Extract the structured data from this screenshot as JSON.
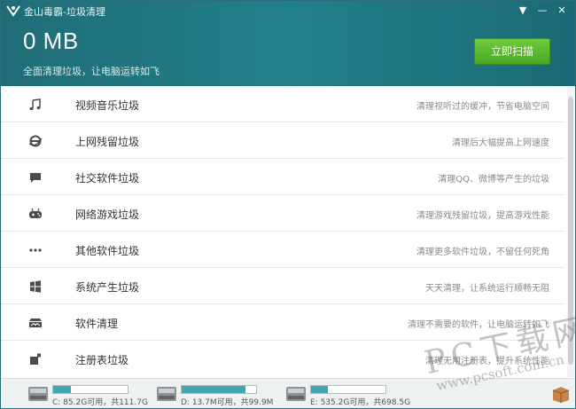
{
  "window": {
    "title": "金山毒霸-垃圾清理",
    "controls": [
      "▼",
      "—",
      "✕"
    ]
  },
  "summary": {
    "size": "0 MB",
    "subtitle": "全面清理垃圾，让电脑运转如飞",
    "scan_button": "立即扫描"
  },
  "categories": [
    {
      "icon": "music-note-icon",
      "title": "视频音乐垃圾",
      "desc": "清理视听过的缓冲，节省电脑空间"
    },
    {
      "icon": "browser-icon",
      "title": "上网残留垃圾",
      "desc": "清理后大幅提高上网速度"
    },
    {
      "icon": "chat-bubble-icon",
      "title": "社交软件垃圾",
      "desc": "清理QQ、微博等产生的垃圾"
    },
    {
      "icon": "gamepad-icon",
      "title": "网络游戏垃圾",
      "desc": "清理游戏残留垃圾，提高游戏性能"
    },
    {
      "icon": "more-dots-icon",
      "title": "其他软件垃圾",
      "desc": "清理更多软件垃圾，不留任何死角"
    },
    {
      "icon": "windows-icon",
      "title": "系统产生垃圾",
      "desc": "天天清理，让系统运行顺畅无阻"
    },
    {
      "icon": "software-icon",
      "title": "软件清理",
      "desc": "清理不需要的软件，让电脑运转如飞"
    },
    {
      "icon": "registry-icon",
      "title": "注册表垃圾",
      "desc": "清理无用注册表，提升系统性能"
    }
  ],
  "disks": [
    {
      "label": "C: 85.2G可用，共111.7G",
      "used_fraction": 0.24
    },
    {
      "label": "D: 13.7M可用，共99.9M",
      "used_fraction": 0.86
    },
    {
      "label": "E: 535.2G可用，共698.5G",
      "used_fraction": 0.23
    }
  ],
  "watermark": {
    "big": "PC下载网",
    "small": "www.pcsoft.com.cn"
  },
  "colors": {
    "header": "#22808a",
    "scan_button": "#4aa825",
    "disk_fill": "#3fa6b3"
  }
}
